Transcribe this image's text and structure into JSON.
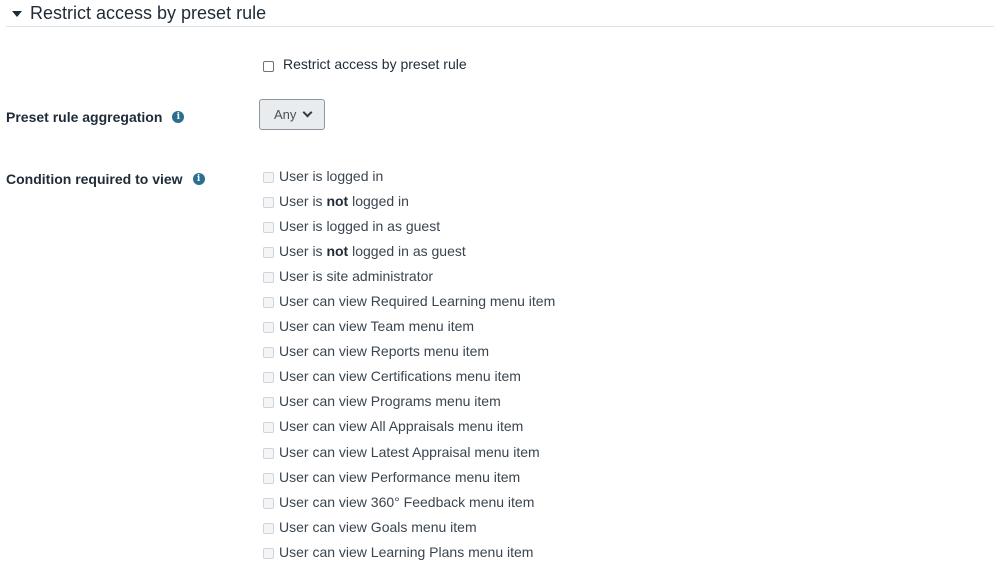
{
  "section": {
    "title": "Restrict access by preset rule"
  },
  "enable_checkbox": {
    "label": "Restrict access by preset rule",
    "checked": false
  },
  "aggregation": {
    "label": "Preset rule aggregation",
    "selected": "Any"
  },
  "conditions": {
    "label": "Condition required to view",
    "items": [
      {
        "pre": "User is logged in",
        "bold": "",
        "post": ""
      },
      {
        "pre": "User is ",
        "bold": "not",
        "post": " logged in"
      },
      {
        "pre": "User is logged in as guest",
        "bold": "",
        "post": ""
      },
      {
        "pre": "User is ",
        "bold": "not",
        "post": " logged in as guest"
      },
      {
        "pre": "User is site administrator",
        "bold": "",
        "post": ""
      },
      {
        "pre": "User can view Required Learning menu item",
        "bold": "",
        "post": ""
      },
      {
        "pre": "User can view Team menu item",
        "bold": "",
        "post": ""
      },
      {
        "pre": "User can view Reports menu item",
        "bold": "",
        "post": ""
      },
      {
        "pre": "User can view Certifications menu item",
        "bold": "",
        "post": ""
      },
      {
        "pre": "User can view Programs menu item",
        "bold": "",
        "post": ""
      },
      {
        "pre": "User can view All Appraisals menu item",
        "bold": "",
        "post": ""
      },
      {
        "pre": "User can view Latest Appraisal menu item",
        "bold": "",
        "post": ""
      },
      {
        "pre": "User can view Performance menu item",
        "bold": "",
        "post": ""
      },
      {
        "pre": "User can view 360° Feedback menu item",
        "bold": "",
        "post": ""
      },
      {
        "pre": "User can view Goals menu item",
        "bold": "",
        "post": ""
      },
      {
        "pre": "User can view Learning Plans menu item",
        "bold": "",
        "post": ""
      }
    ]
  },
  "colors": {
    "text": "#1f2b37",
    "info_icon": "#2a6f8f",
    "select_bg": "#e9ecef"
  }
}
